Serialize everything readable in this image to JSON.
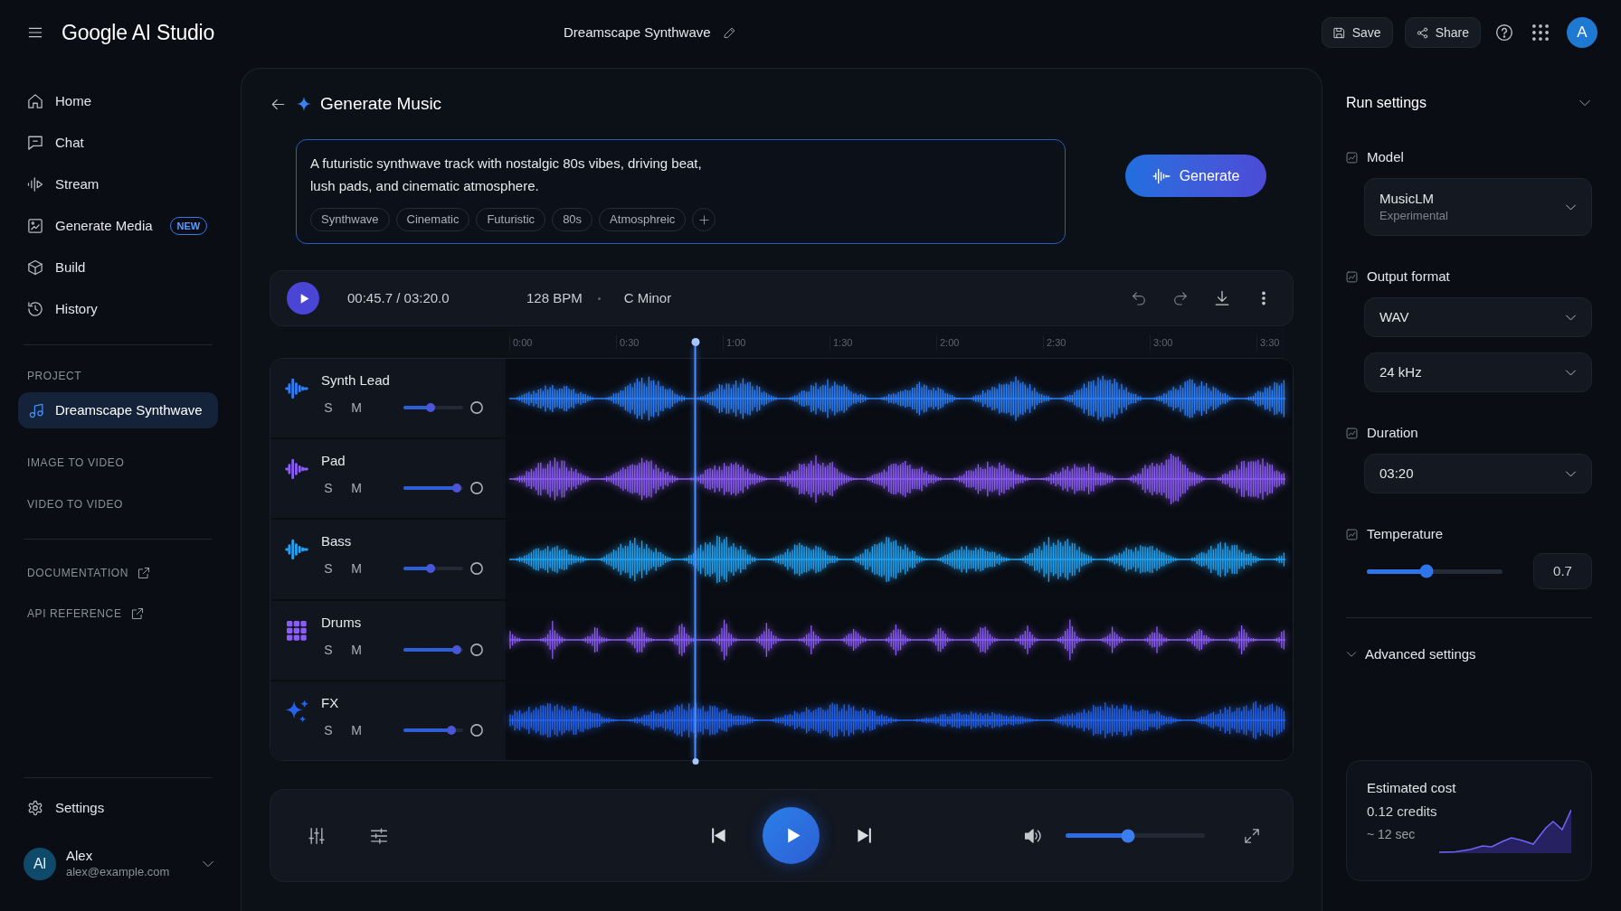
{
  "header": {
    "logo": "Google AI Studio",
    "project_title": "Dreamscape Synthwave",
    "buttons": [
      {
        "label": "Save"
      },
      {
        "label": "Share"
      }
    ],
    "avatar": "A"
  },
  "sidebar": {
    "nav": [
      {
        "label": "Home"
      },
      {
        "label": "Chat"
      },
      {
        "label": "Stream"
      },
      {
        "label": "Generate Media",
        "badge": "NEW"
      },
      {
        "label": "Build"
      },
      {
        "label": "History"
      }
    ],
    "project_heading": "PROJECT",
    "projects": [
      {
        "label": "Dreamscape Synthwave",
        "selected": true
      }
    ],
    "sections": [
      "IMAGE TO VIDEO",
      "VIDEO TO VIDEO"
    ],
    "links": [
      "DOCUMENTATION",
      "API REFERENCE"
    ],
    "settings": "Settings",
    "user": {
      "initials": "Al",
      "name": "Alex",
      "email": "alex@example.com"
    }
  },
  "generator": {
    "title": "Generate Music",
    "prompt": "A futuristic synthwave track with nostalgic 80s vibes, driving beat, lush pads, and cinematic atmosphere.",
    "tags": [
      "Synthwave",
      "Cinematic",
      "Futuristic",
      "80s",
      "Atmosphreic"
    ],
    "generate_button": "Generate"
  },
  "transport": {
    "time": "00:45.7 / 03:20.0",
    "tempo": "128 BPM",
    "key": "C Minor",
    "playhead": {
      "level": 0.24
    }
  },
  "timeline": {
    "ticks": [
      "0:00",
      "0:30",
      "1:00",
      "1:30",
      "2:00",
      "2:30",
      "3:00",
      "3:30"
    ]
  },
  "tracks": [
    {
      "name": "Synth Lead",
      "kind": "tonal",
      "color": "#2e7ff7",
      "solo": "S",
      "mute": "M",
      "level": 0.45
    },
    {
      "name": "Pad",
      "kind": "tonal",
      "color": "#8b5cf6",
      "solo": "S",
      "mute": "M",
      "level": 0.9
    },
    {
      "name": "Bass",
      "kind": "tonal",
      "color": "#22a3f2",
      "solo": "S",
      "mute": "M",
      "level": 0.45
    },
    {
      "name": "Drums",
      "kind": "percussion",
      "color": "#8b5cf6",
      "solo": "S",
      "mute": "M",
      "level": 0.9
    },
    {
      "name": "FX",
      "kind": "effect",
      "color": "#2563eb",
      "solo": "S",
      "mute": "M",
      "level": 0.8
    }
  ],
  "player": {
    "volume": {
      "level": 0.45
    }
  },
  "run_settings": {
    "title": "Run settings",
    "sections": [
      {
        "label": "Model",
        "kind": "select",
        "selects": [
          {
            "value": "MusicLM",
            "note": "Experimental"
          }
        ]
      },
      {
        "label": "Output format",
        "kind": "select",
        "selects": [
          {
            "value": "WAV"
          },
          {
            "value": "24 kHz"
          }
        ]
      },
      {
        "label": "Duration",
        "kind": "select",
        "selects": [
          {
            "value": "03:20"
          }
        ]
      },
      {
        "label": "Temperature",
        "kind": "slider",
        "level": 0.44,
        "value": "0.7"
      }
    ],
    "advanced": "Advanced settings",
    "cost": {
      "title": "Estimated cost",
      "credits": "0.12 credits",
      "duration": "~ 12 sec"
    }
  }
}
